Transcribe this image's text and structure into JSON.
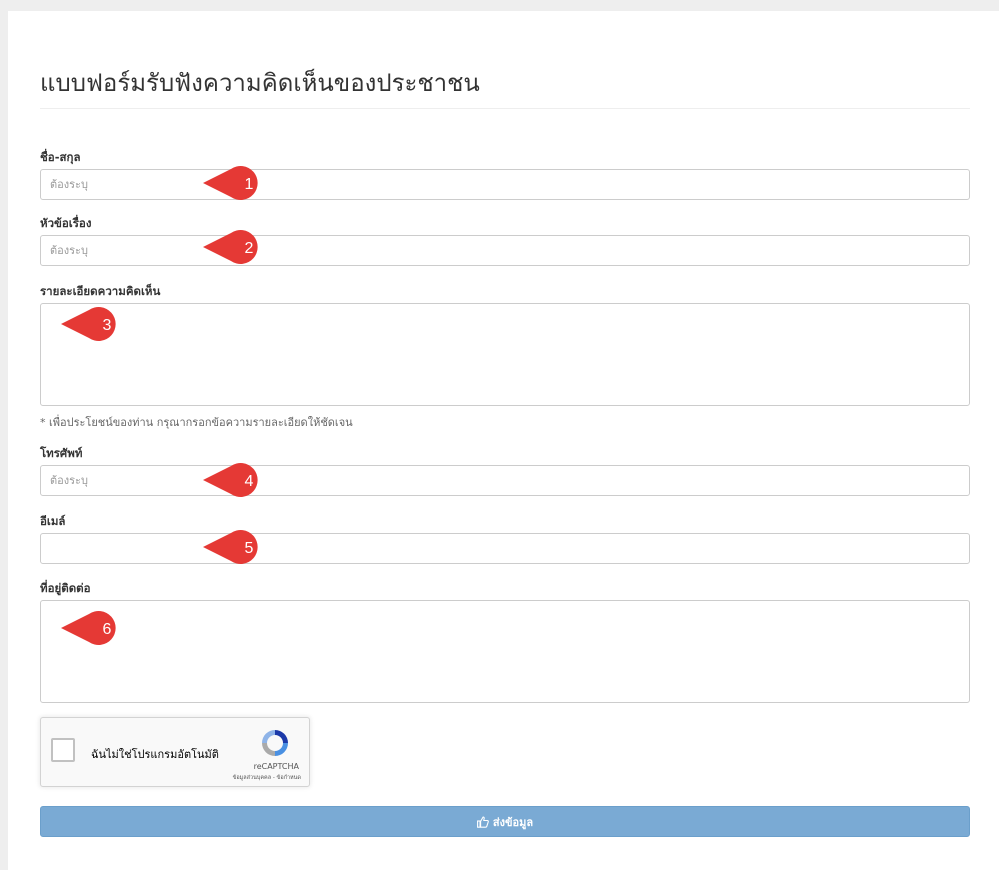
{
  "form": {
    "title": "แบบฟอร์มรับฟังความคิดเห็นของประชาชน",
    "fields": [
      {
        "label": "ชื่อ-สกุล",
        "placeholder": "ต้องระบุ",
        "value": ""
      },
      {
        "label": "หัวข้อเรื่อง",
        "placeholder": "ต้องระบุ",
        "value": ""
      },
      {
        "label": "รายละเอียดความคิดเห็น",
        "placeholder": "",
        "value": "",
        "help": "* เพื่อประโยชน์ของท่าน กรุณากรอกข้อความรายละเอียดให้ชัดเจน"
      },
      {
        "label": "โทรศัพท์",
        "placeholder": "ต้องระบุ",
        "value": ""
      },
      {
        "label": "อีเมล์",
        "placeholder": "",
        "value": ""
      },
      {
        "label": "ที่อยู่ติดต่อ",
        "placeholder": "",
        "value": ""
      }
    ],
    "recaptcha": {
      "checked": false,
      "label": "ฉันไม่ใช่โปรแกรมอัตโนมัติ",
      "brand": "reCAPTCHA",
      "links": "ข้อมูลส่วนบุคคล - ข้อกำหนด",
      "icon": "recaptcha-logo-icon"
    },
    "submit": {
      "label": "ส่งข้อมูล",
      "icon": "thumbs-up-icon"
    }
  },
  "annotations": [
    "1",
    "2",
    "3",
    "4",
    "5",
    "6"
  ],
  "colors": {
    "badge": "#e53935",
    "submit": "#7aaad4",
    "field_border": "#cccccc",
    "page_background": "#eeeeee"
  }
}
